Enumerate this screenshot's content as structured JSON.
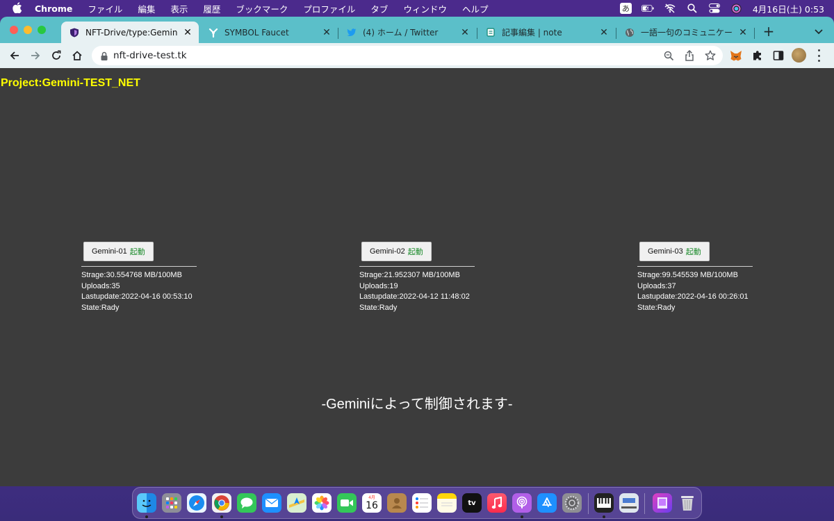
{
  "menubar": {
    "app_name": "Chrome",
    "menus": [
      "ファイル",
      "編集",
      "表示",
      "履歴",
      "ブックマーク",
      "プロファイル",
      "タブ",
      "ウィンドウ",
      "ヘルプ"
    ],
    "ime_label": "あ",
    "clock": "4月16日(土)  0:53",
    "icons": [
      "apple-icon",
      "battery-icon",
      "wifi-off-icon",
      "spotlight-search-icon",
      "control-center-icon",
      "siri-icon"
    ]
  },
  "tabs": [
    {
      "title": "NFT-Drive/type:Gemini-TE",
      "favicon": "shield-favicon",
      "active": true
    },
    {
      "title": "SYMBOL Faucet",
      "favicon": "symbol-favicon",
      "active": false
    },
    {
      "title": "(4) ホーム / Twitter",
      "favicon": "twitter-favicon",
      "active": false
    },
    {
      "title": "記事編集 | note",
      "favicon": "note-favicon",
      "active": false
    },
    {
      "title": "一語一句のコミュニケーショ",
      "favicon": "globe-favicon",
      "active": false
    }
  ],
  "toolbar": {
    "url": "nft-drive-test.tk",
    "icons": [
      "back-icon",
      "forward-icon",
      "reload-icon",
      "home-icon",
      "lock-icon",
      "zoom-icon",
      "share-icon",
      "bookmark-star-icon",
      "metamask-icon",
      "extensions-icon",
      "side-panel-icon",
      "profile-avatar",
      "menu-icon"
    ]
  },
  "page": {
    "project_title": "Project:Gemini-TEST_NET",
    "nodes": [
      {
        "name": "Gemini-01",
        "status": "起動",
        "storage": "Strage:30.554768 MB/100MB",
        "uploads": "Uploads:35",
        "lastupdate": "Lastupdate:2022-04-16 00:53:10",
        "state": "State:Rady"
      },
      {
        "name": "Gemini-02",
        "status": "起動",
        "storage": "Strage:21.952307 MB/100MB",
        "uploads": "Uploads:19",
        "lastupdate": "Lastupdate:2022-04-12 11:48:02",
        "state": "State:Rady"
      },
      {
        "name": "Gemini-03",
        "status": "起動",
        "storage": "Strage:99.545539 MB/100MB",
        "uploads": "Uploads:37",
        "lastupdate": "Lastupdate:2022-04-16 00:26:01",
        "state": "State:Rady"
      }
    ],
    "footer": "-Geminiによって制御されます-"
  },
  "dock": {
    "calendar_month": "4月",
    "calendar_day": "16",
    "tv_label": "tv",
    "apps": [
      "finder-icon",
      "launchpad-icon",
      "safari-icon",
      "chrome-icon",
      "messages-icon",
      "mail-icon",
      "maps-icon",
      "photos-icon",
      "facetime-icon",
      "calendar-icon",
      "contacts-icon",
      "reminders-icon",
      "notes-icon",
      "apple-tv-icon",
      "music-icon",
      "podcasts-icon",
      "app-store-icon",
      "system-preferences-icon",
      "piano-icon",
      "preview-icon",
      "image-viewer-icon",
      "trash-icon"
    ]
  },
  "colors": {
    "project_title": "#ffff00",
    "status": "#1a8a2a",
    "page_bg": "#3c3c3c",
    "tabstrip": "#5bbfc9"
  }
}
